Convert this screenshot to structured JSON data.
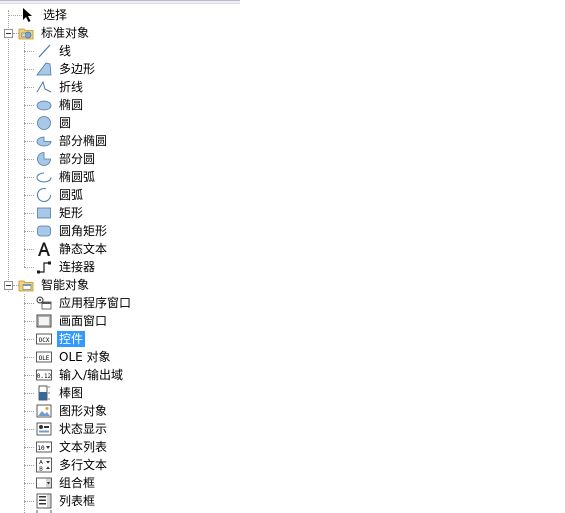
{
  "tree": {
    "select": "选择",
    "groups": [
      {
        "label": "标准对象",
        "items": [
          {
            "label": "线",
            "icon": "line-icon"
          },
          {
            "label": "多边形",
            "icon": "polygon-icon"
          },
          {
            "label": "折线",
            "icon": "polyline-icon"
          },
          {
            "label": "椭圆",
            "icon": "ellipse-icon"
          },
          {
            "label": "圆",
            "icon": "circle-icon"
          },
          {
            "label": "部分椭圆",
            "icon": "ellipse-segment-icon"
          },
          {
            "label": "部分圆",
            "icon": "circle-segment-icon"
          },
          {
            "label": "椭圆弧",
            "icon": "ellipse-arc-icon"
          },
          {
            "label": "圆弧",
            "icon": "circle-arc-icon"
          },
          {
            "label": "矩形",
            "icon": "rectangle-icon"
          },
          {
            "label": "圆角矩形",
            "icon": "rounded-rectangle-icon"
          },
          {
            "label": "静态文本",
            "icon": "static-text-icon"
          },
          {
            "label": "连接器",
            "icon": "connector-icon"
          }
        ]
      },
      {
        "label": "智能对象",
        "items": [
          {
            "label": "应用程序窗口",
            "icon": "application-window-icon"
          },
          {
            "label": "画面窗口",
            "icon": "picture-window-icon"
          },
          {
            "label": "控件",
            "icon": "ocx-control-icon",
            "selected": true
          },
          {
            "label": "OLE 对象",
            "icon": "ole-object-icon"
          },
          {
            "label": "输入/输出域",
            "icon": "io-field-icon"
          },
          {
            "label": "棒图",
            "icon": "bar-graph-icon"
          },
          {
            "label": "图形对象",
            "icon": "graphic-object-icon"
          },
          {
            "label": "状态显示",
            "icon": "status-display-icon"
          },
          {
            "label": "文本列表",
            "icon": "text-list-icon"
          },
          {
            "label": "多行文本",
            "icon": "multiline-text-icon"
          },
          {
            "label": "组合框",
            "icon": "combo-box-icon"
          },
          {
            "label": "列表框",
            "icon": "list-box-icon"
          }
        ]
      }
    ],
    "colors": {
      "selection": "#3399ff",
      "icon_fill": "#a8c8e8",
      "icon_stroke": "#4a78a8"
    }
  }
}
